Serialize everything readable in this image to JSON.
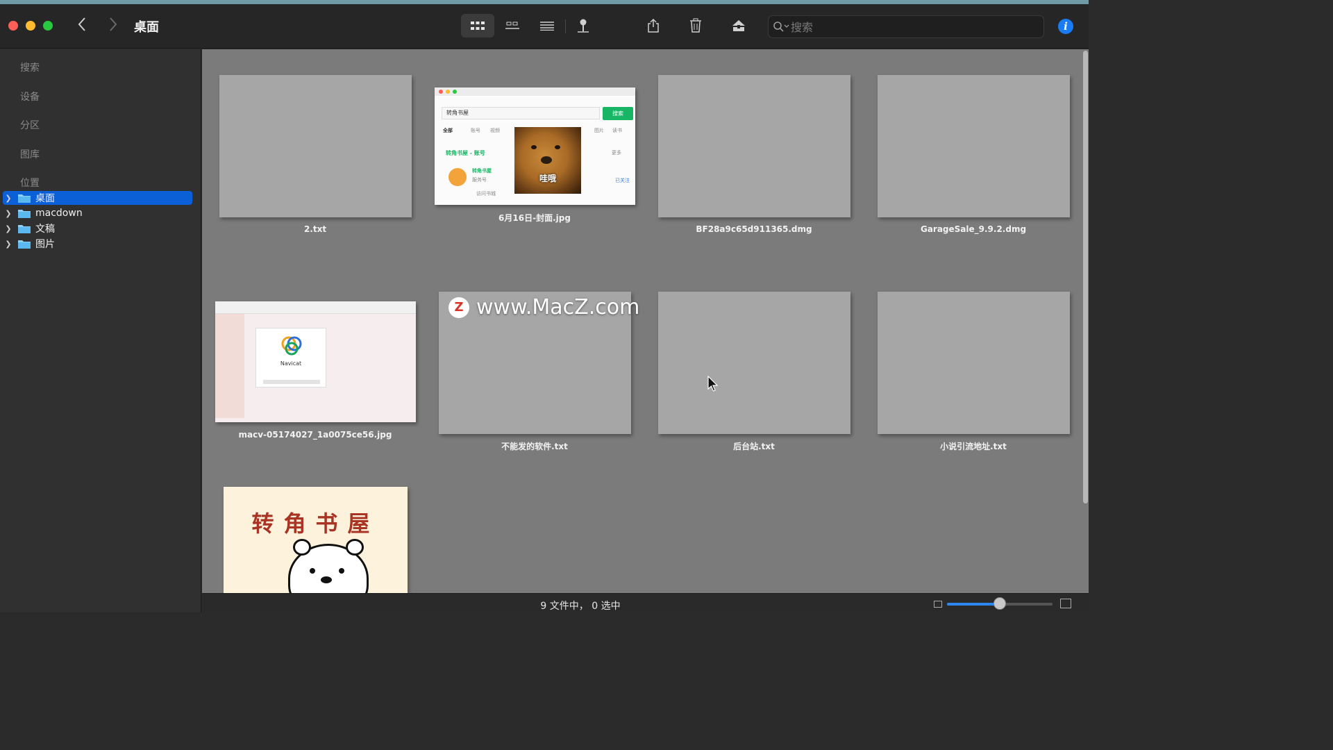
{
  "window": {
    "title": "桌面"
  },
  "toolbar": {
    "back_icon": "chevron-left-icon",
    "forward_icon": "chevron-right-icon",
    "view_buttons": [
      "icon-view",
      "gallery-view",
      "list-view",
      "pin"
    ],
    "actions": [
      "share-icon",
      "trash-icon",
      "eject-icon"
    ],
    "info_label": "i"
  },
  "search": {
    "placeholder": "搜索"
  },
  "sidebar": {
    "sections": [
      "搜索",
      "设备",
      "分区",
      "图库",
      "位置"
    ],
    "items": [
      {
        "label": "桌面",
        "selected": true
      },
      {
        "label": "macdown",
        "selected": false
      },
      {
        "label": "文稿",
        "selected": false
      },
      {
        "label": "图片",
        "selected": false
      }
    ]
  },
  "files": [
    {
      "name": "2.txt",
      "kind": "text"
    },
    {
      "name": "6月16日-封面.jpg",
      "kind": "image"
    },
    {
      "name": "BF28a9c65d911365.dmg",
      "kind": "disk"
    },
    {
      "name": "GarageSale_9.9.2.dmg",
      "kind": "disk"
    },
    {
      "name": "macv-05174027_1a0075ce56.jpg",
      "kind": "image"
    },
    {
      "name": "不能发的软件.txt",
      "kind": "text"
    },
    {
      "name": "后台站.txt",
      "kind": "text"
    },
    {
      "name": "小说引流地址.txt",
      "kind": "text"
    },
    {
      "name": "",
      "kind": "image"
    }
  ],
  "thumbnail1": {
    "query": "转角书屋",
    "search_button": "搜索",
    "tabs": [
      "全部",
      "账号",
      "视频",
      "图片",
      "读书"
    ],
    "result_title": "转角书屋 - 账号",
    "account_name": "转角书屋",
    "account_type": "服务号",
    "more": "更多",
    "followed": "已关注",
    "visit": "访问书城",
    "meme_caption": "哇哦"
  },
  "thumbnail2": {
    "app_name": "Navicat"
  },
  "thumbnail3": {
    "heading": "转角书屋"
  },
  "watermark": {
    "logo": "Z",
    "text": "www.MacZ.com"
  },
  "status": {
    "text": "9 文件中， 0 选中"
  },
  "zoom": {
    "level": 0.5
  },
  "colors": {
    "selection": "#0b5fd7",
    "accent_strip": "#6f9aa6",
    "info": "#1a7cf5"
  }
}
